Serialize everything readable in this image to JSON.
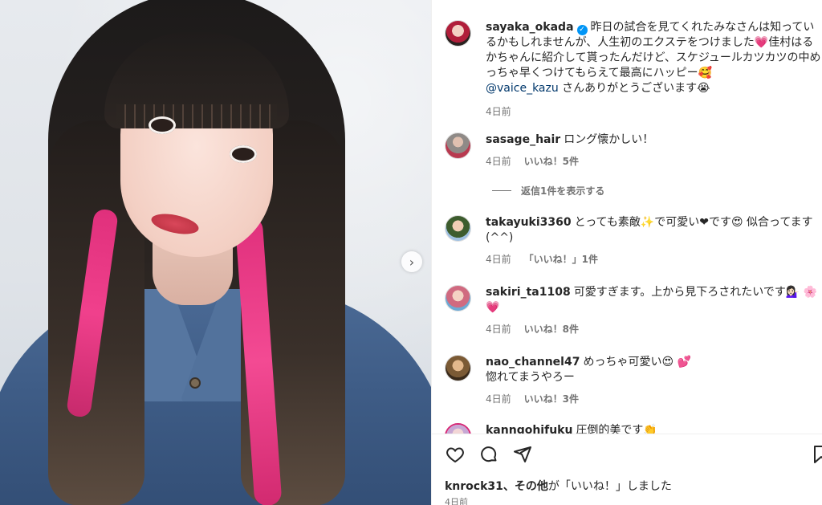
{
  "post": {
    "author": "sayaka_okada",
    "caption": "昨日の試合を見てくれたみなさんは知っているかもしれませんが、人生初のエクステをつけました💗佳村はるかちゃんに紹介して貰ったんだけど、スケジュールカツカツの中めっちゃ早くつけてもらえて最高にハッピー🥰",
    "mention": "@vaice_kazu",
    "caption_tail": " さんありがとうございます😭",
    "time": "4日前"
  },
  "comments": [
    {
      "user": "sasage_hair",
      "text": "ロング懐かしい！",
      "time": "4日前",
      "likes": "いいね！5件",
      "avatar_color": "#8f8a87"
    },
    {
      "user": "takayuki3360",
      "text": "とっても素敵✨で可愛い❤です😍 似合ってます(^^)",
      "time": "4日前",
      "likes": "「いいね！」1件",
      "avatar_color": "#5b7d4f"
    },
    {
      "user": "sakiri_ta1108",
      "text": "可愛すぎます。上から見下ろされたいです💁🏻‍♀️ 🌸💗",
      "time": "4日前",
      "likes": "いいね！8件",
      "avatar_color": "#b76b74"
    },
    {
      "user": "nao_channel47",
      "text": "めっちゃ可愛い😍 💕\n惚れてまうやろー",
      "time": "4日前",
      "likes": "いいね！3件",
      "avatar_color": "#7b5a35"
    },
    {
      "user": "kanngohifuku",
      "text": "圧倒的美です👏",
      "avatar_color": "#c7a7d4"
    }
  ],
  "replies": {
    "label": "返信1件を表示する"
  },
  "footer": {
    "liked_by_user": "knrock31",
    "liked_by_others": "、その他",
    "liked_by_suffix": "が「いいね！」しました",
    "time": "4日前"
  },
  "icons": {
    "like": "heart-icon",
    "comment": "comment-icon",
    "share": "share-icon",
    "save": "bookmark-icon",
    "next": "chevron-right-icon",
    "verified": "verified-badge-icon"
  },
  "colors": {
    "verified": "#0095f6",
    "mention": "#00376b",
    "pink_hair": "#e0307c"
  }
}
